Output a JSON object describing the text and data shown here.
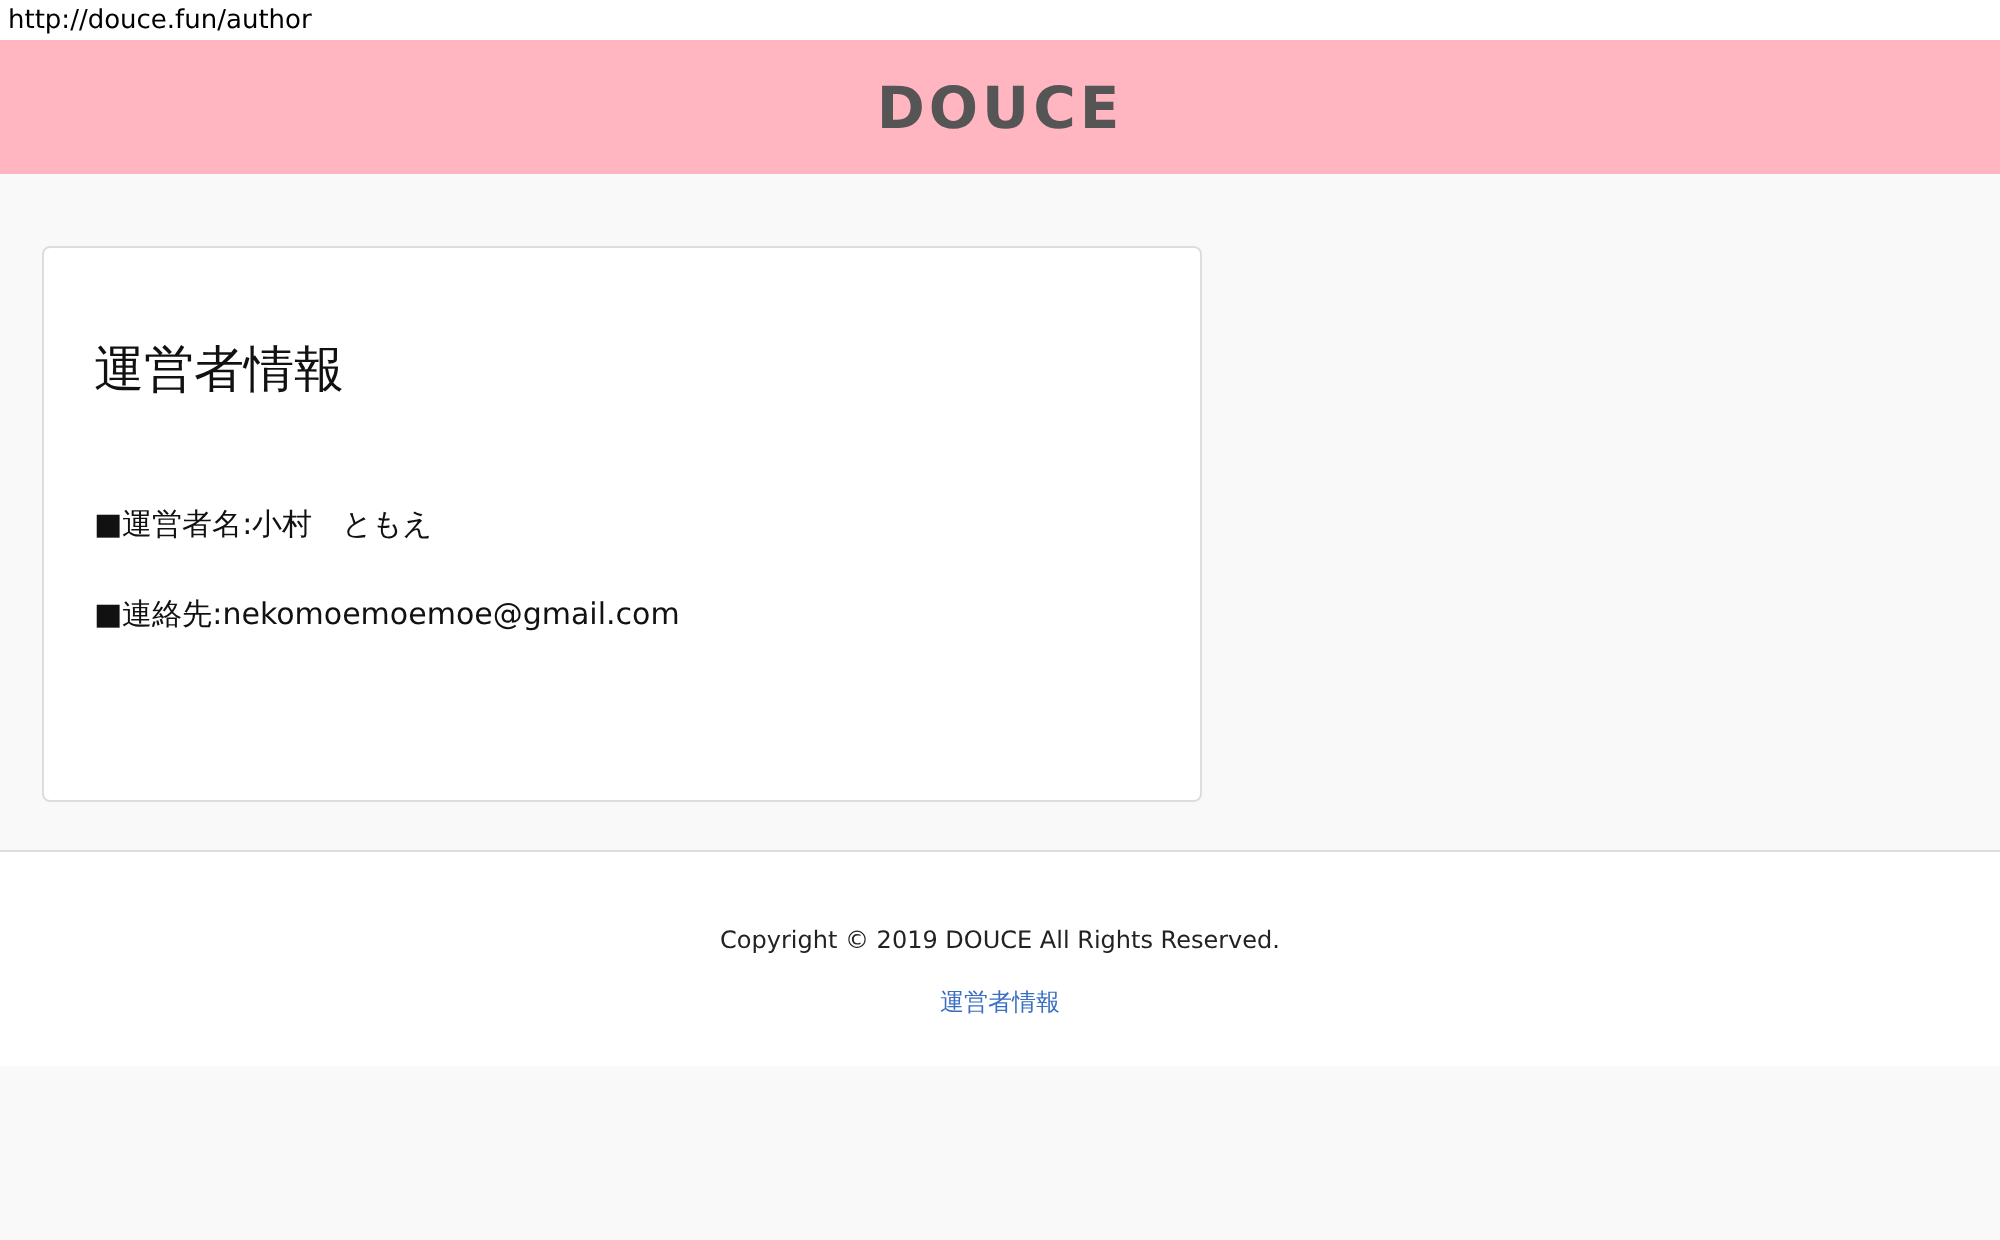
{
  "url": "http://douce.fun/author",
  "header": {
    "logo": "DOUCE"
  },
  "card": {
    "title": "運営者情報",
    "lines": [
      "■運営者名:小村　ともえ",
      "■連絡先:nekomoemoemoe@gmail.com"
    ]
  },
  "footer": {
    "copyright": "Copyright © 2019 DOUCE All Rights Reserved.",
    "links": [
      "運営者情報"
    ]
  }
}
